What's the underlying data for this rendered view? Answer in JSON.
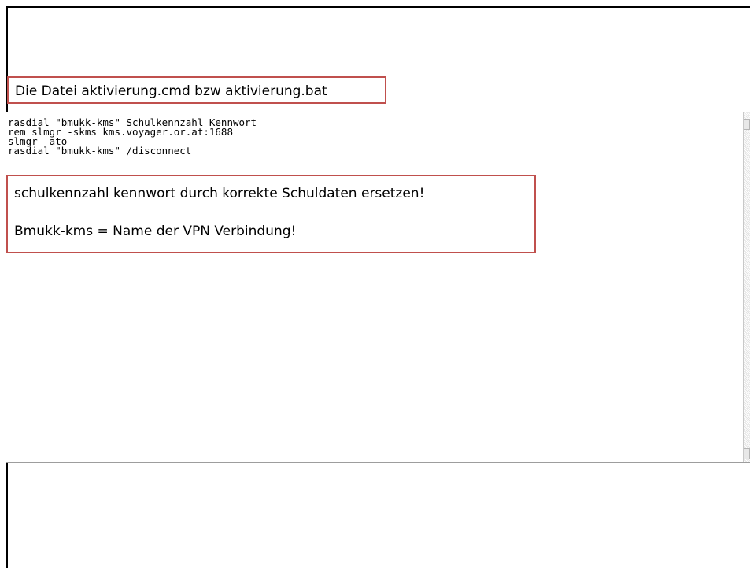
{
  "title_callout": {
    "text": "Die Datei aktivierung.cmd  bzw aktivierung.bat"
  },
  "editor": {
    "lines": [
      "rasdial \"bmukk-kms\" Schulkennzahl Kennwort",
      "rem slmgr -skms kms.voyager.or.at:1688",
      "slmgr -ato",
      "rasdial \"bmukk-kms\" /disconnect"
    ]
  },
  "note_callout": {
    "line1": "schulkennzahl   kennwort durch korrekte Schuldaten ersetzen!",
    "line2": "Bmukk-kms  = Name der VPN Verbindung!"
  },
  "colors": {
    "callout_border": "#c0504d",
    "slide_border": "#000000"
  }
}
